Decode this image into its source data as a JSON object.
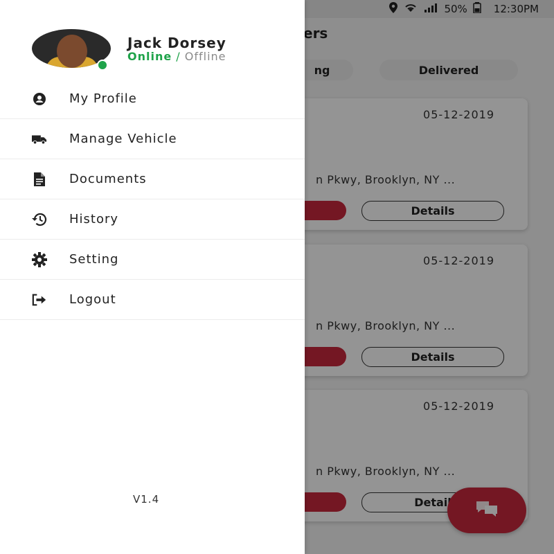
{
  "status_bar": {
    "battery": "50%",
    "time": "12:30PM"
  },
  "background": {
    "title_partial": "ers",
    "tabs": [
      {
        "label": "ng"
      },
      {
        "label": "Delivered"
      }
    ],
    "cards": [
      {
        "date": "05-12-2019",
        "address": "n Pkwy, Brooklyn, NY ...",
        "details_label": "Details"
      },
      {
        "date": "05-12-2019",
        "address": "n Pkwy, Brooklyn, NY ...",
        "details_label": "Details"
      },
      {
        "date": "05-12-2019",
        "address": "n Pkwy, Brooklyn, NY ...",
        "details_label": "Detail"
      }
    ]
  },
  "drawer": {
    "user": {
      "name": "Jack Dorsey",
      "status_online": "Online",
      "status_separator": " / ",
      "status_offline": "Offline"
    },
    "menu": [
      {
        "label": "My Profile",
        "icon": "profile-icon"
      },
      {
        "label": "Manage Vehicle",
        "icon": "truck-icon"
      },
      {
        "label": "Documents",
        "icon": "document-icon"
      },
      {
        "label": "History",
        "icon": "history-icon"
      },
      {
        "label": "Setting",
        "icon": "gear-icon"
      },
      {
        "label": "Logout",
        "icon": "logout-icon"
      }
    ],
    "version": "V1.4"
  },
  "colors": {
    "accent": "#c8283d",
    "online": "#1fa34a"
  }
}
